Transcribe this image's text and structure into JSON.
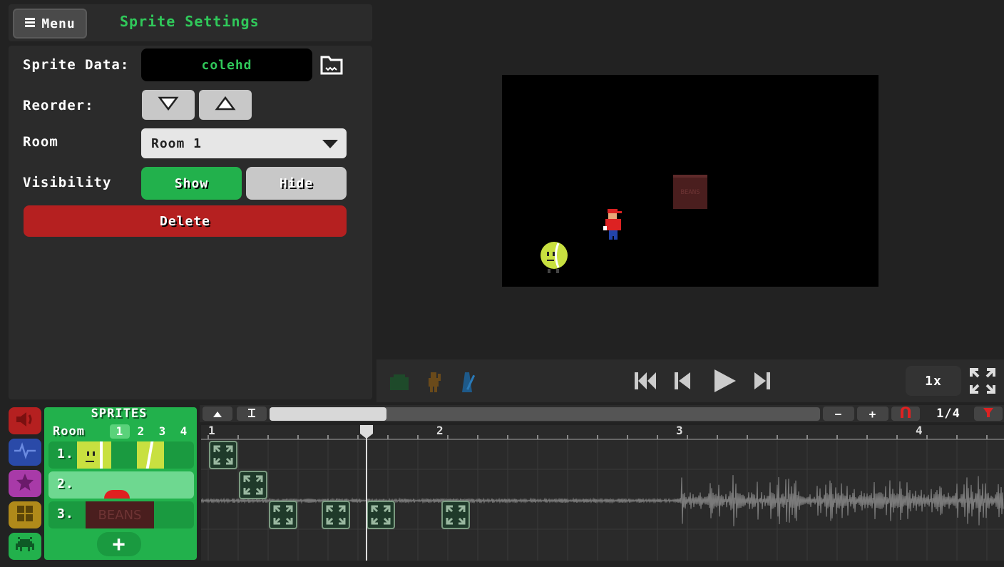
{
  "header": {
    "menu_label": "Menu",
    "panel_title": "Sprite Settings"
  },
  "settings": {
    "sprite_data_label": "Sprite Data:",
    "sprite_data_value": "colehd",
    "reorder_label": "Reorder:",
    "room_label": "Room",
    "room_selected": "Room 1",
    "visibility_label": "Visibility",
    "show_label": "Show",
    "hide_label": "Hide",
    "delete_label": "Delete"
  },
  "preview": {
    "box_text": "BEANS"
  },
  "playback": {
    "speed_label": "1x"
  },
  "sprites_panel": {
    "title": "SPRITES",
    "room_label": "Room",
    "room_tabs": [
      "1",
      "2",
      "3",
      "4"
    ],
    "active_room_tab": "1",
    "rows": [
      {
        "num": "1."
      },
      {
        "num": "2."
      },
      {
        "num": "3.",
        "thumb_text": "BEANS"
      }
    ],
    "add_label": "+"
  },
  "timeline": {
    "zoom_out_label": "−",
    "zoom_in_label": "+",
    "snap_label": "1/4",
    "ruler_marks": [
      "1",
      "2",
      "3",
      "4"
    ]
  },
  "colors": {
    "accent_green": "#22b14c",
    "title_green": "#30c85a",
    "delete_red": "#b52020",
    "panel_bg": "#2b2b2b"
  }
}
